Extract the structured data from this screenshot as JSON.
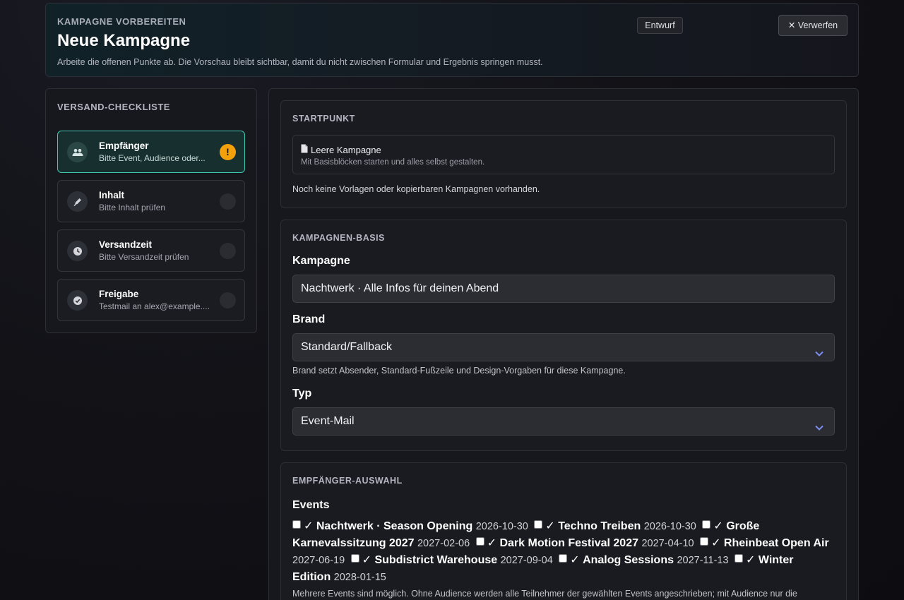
{
  "header": {
    "eyebrow": "KAMPAGNE VORBEREITEN",
    "title": "Neue Kampagne",
    "subtitle": "Arbeite die offenen Punkte ab. Die Vorschau bleibt sichtbar, damit du nicht zwischen Formular und Ergebnis springen musst.",
    "status_badge": "Entwurf",
    "discard_label": "✕ Verwerfen"
  },
  "sidebar": {
    "title": "VERSAND-CHECKLISTE",
    "steps": [
      {
        "label": "Empfänger",
        "desc": "Bitte Event, Audience oder...",
        "status": "!",
        "icon": "users-icon"
      },
      {
        "label": "Inhalt",
        "desc": "Bitte Inhalt prüfen",
        "status": "",
        "icon": "pen-icon"
      },
      {
        "label": "Versandzeit",
        "desc": "Bitte Versandzeit prüfen",
        "status": "",
        "icon": "clock-icon"
      },
      {
        "label": "Freigabe",
        "desc": "Testmail an alex@example....",
        "status": "",
        "icon": "check-circle-icon"
      }
    ]
  },
  "start": {
    "title": "STARTPUNKT",
    "option_title": "Leere Kampagne",
    "option_desc": "Mit Basisblöcken starten und alles selbst gestalten.",
    "note": "Noch keine Vorlagen oder kopierbaren Kampagnen vorhanden."
  },
  "basis": {
    "title": "KAMPAGNEN-BASIS",
    "campaign_label": "Kampagne",
    "campaign_value": "Nachtwerk · Alle Infos für deinen Abend",
    "brand_label": "Brand",
    "brand_value": "Standard/Fallback",
    "brand_hint": "Brand setzt Absender, Standard-Fußzeile und Design-Vorgaben für diese Kampagne.",
    "type_label": "Typ",
    "type_value": "Event-Mail"
  },
  "recipients": {
    "title": "EMPFÄNGER-AUSWAHL",
    "events_label": "Events",
    "check_glyph": "✓",
    "events": [
      {
        "name": "Nachtwerk · Season Opening",
        "date": "2026-10-30"
      },
      {
        "name": "Techno Treiben",
        "date": "2026-10-30"
      },
      {
        "name": "Große Karnevalssitzung 2027",
        "date": "2027-02-06"
      },
      {
        "name": "Dark Motion Festival 2027",
        "date": "2027-04-10"
      },
      {
        "name": "Rheinbeat Open Air",
        "date": "2027-06-19"
      },
      {
        "name": "Subdistrict Warehouse",
        "date": "2027-09-04"
      },
      {
        "name": "Analog Sessions",
        "date": "2027-11-13"
      },
      {
        "name": "Winter Edition",
        "date": "2028-01-15"
      }
    ],
    "footnote": "Mehrere Events sind möglich. Ohne Audience werden alle Teilnehmer der gewählten Events angeschrieben; mit Audience nur die"
  },
  "colors": {
    "accent": "#3fc9b0",
    "warning": "#f2a10c",
    "chevron": "#7c8cf0"
  }
}
